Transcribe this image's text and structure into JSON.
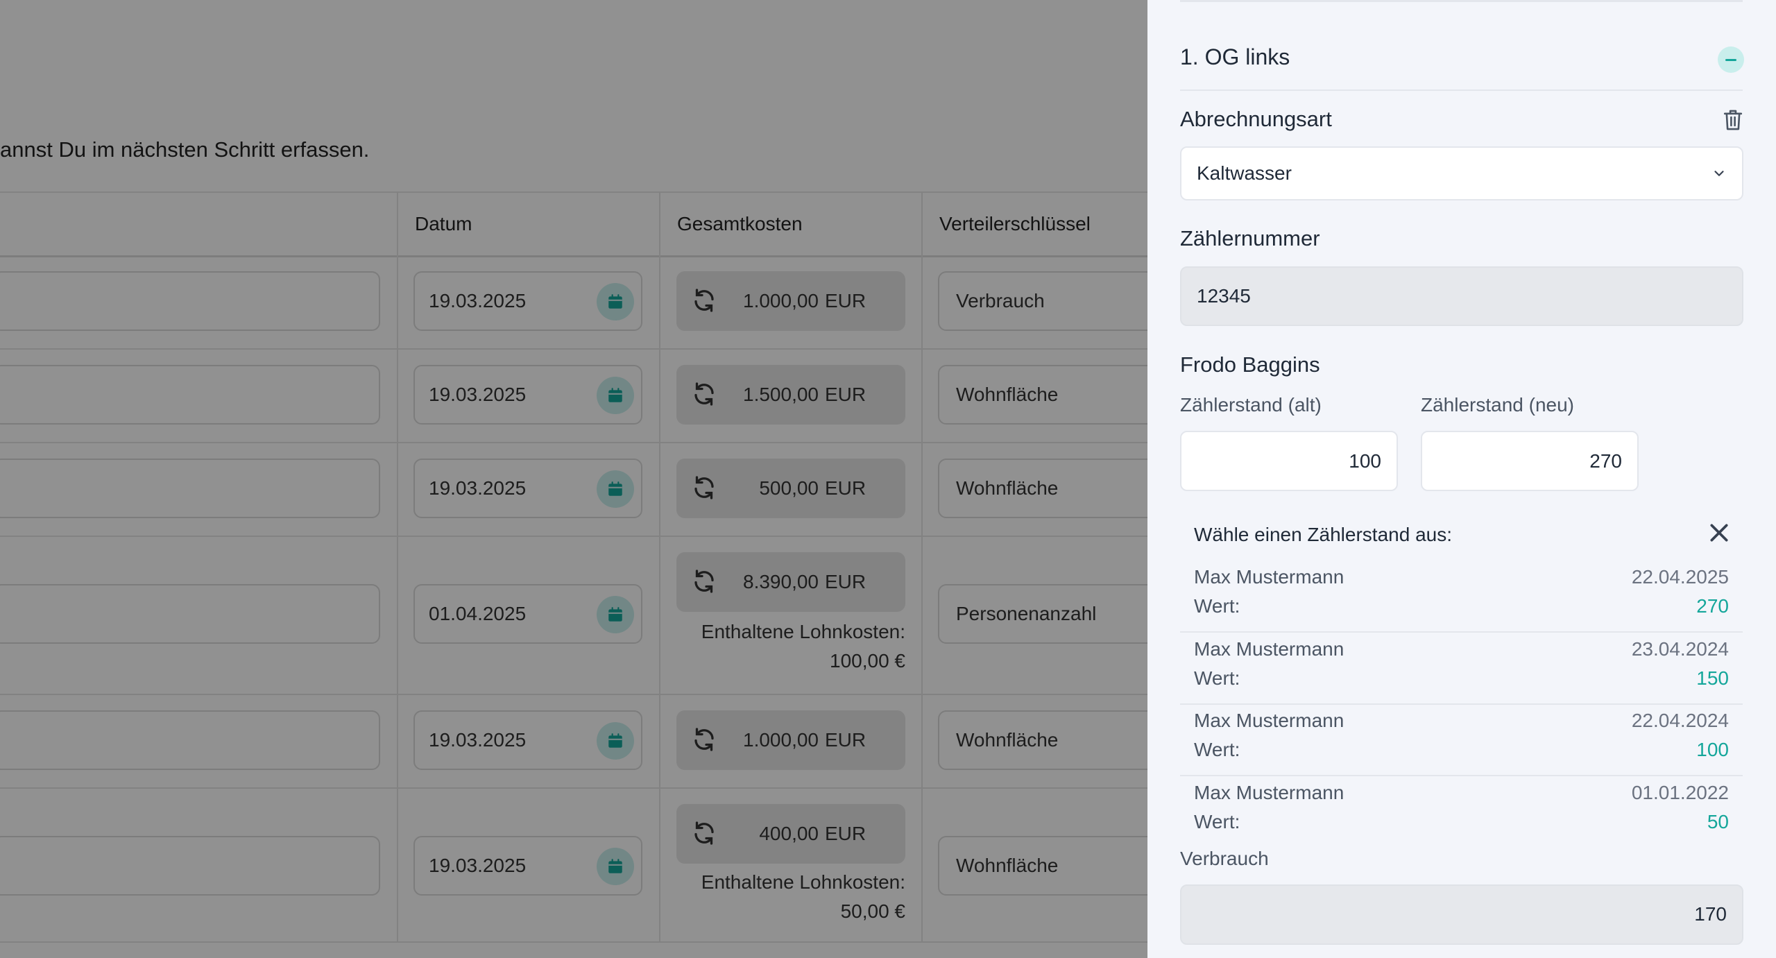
{
  "background": {
    "intro_text": "annst Du im nächsten Schritt erfassen.",
    "columns": {
      "datum": "Datum",
      "gesamtkosten": "Gesamtkosten",
      "verteiler": "Verteilerschlüssel"
    },
    "currency": "EUR",
    "lohn_label": "Enthaltene Lohnkosten:",
    "rows": [
      {
        "date": "19.03.2025",
        "amount": "1.000,00",
        "key": "Verbrauch",
        "lohn": ""
      },
      {
        "date": "19.03.2025",
        "amount": "1.500,00",
        "key": "Wohnfläche",
        "lohn": ""
      },
      {
        "date": "19.03.2025",
        "amount": "500,00",
        "key": "Wohnfläche",
        "lohn": ""
      },
      {
        "date": "01.04.2025",
        "amount": "8.390,00",
        "key": "Personenanzahl",
        "lohn": "100,00 €"
      },
      {
        "date": "19.03.2025",
        "amount": "1.000,00",
        "key": "Wohnfläche",
        "lohn": ""
      },
      {
        "date": "19.03.2025",
        "amount": "400,00",
        "key": "Wohnfläche",
        "lohn": "50,00 €"
      }
    ]
  },
  "panel": {
    "section_title": "1. OG links",
    "abrechnungsart_label": "Abrechnungsart",
    "abrechnungsart_value": "Kaltwasser",
    "zaehlernummer_label": "Zählernummer",
    "zaehlernummer_value": "12345",
    "tenant_name": "Frodo Baggins",
    "stand_alt_label": "Zählerstand (alt)",
    "stand_alt_value": "100",
    "stand_neu_label": "Zählerstand (neu)",
    "stand_neu_value": "270",
    "picker_title": "Wähle einen Zählerstand aus:",
    "picker_value_label": "Wert:",
    "readings": [
      {
        "name": "Max Mustermann",
        "date": "22.04.2025",
        "value": "270"
      },
      {
        "name": "Max Mustermann",
        "date": "23.04.2024",
        "value": "150"
      },
      {
        "name": "Max Mustermann",
        "date": "22.04.2024",
        "value": "100"
      },
      {
        "name": "Max Mustermann",
        "date": "01.01.2022",
        "value": "50"
      }
    ],
    "verbrauch_label": "Verbrauch",
    "verbrauch_value": "170"
  },
  "icons": {
    "calendar": "calendar-icon",
    "refresh": "refresh-icon",
    "trash": "trash-icon",
    "chevron": "chevron-down-icon",
    "close": "close-icon",
    "collapse": "minus-icon"
  },
  "colors": {
    "accent": "#14a69a",
    "accent_light": "#c9eeec",
    "panel_bg": "#f3f5fa",
    "overlay": "#000000"
  }
}
